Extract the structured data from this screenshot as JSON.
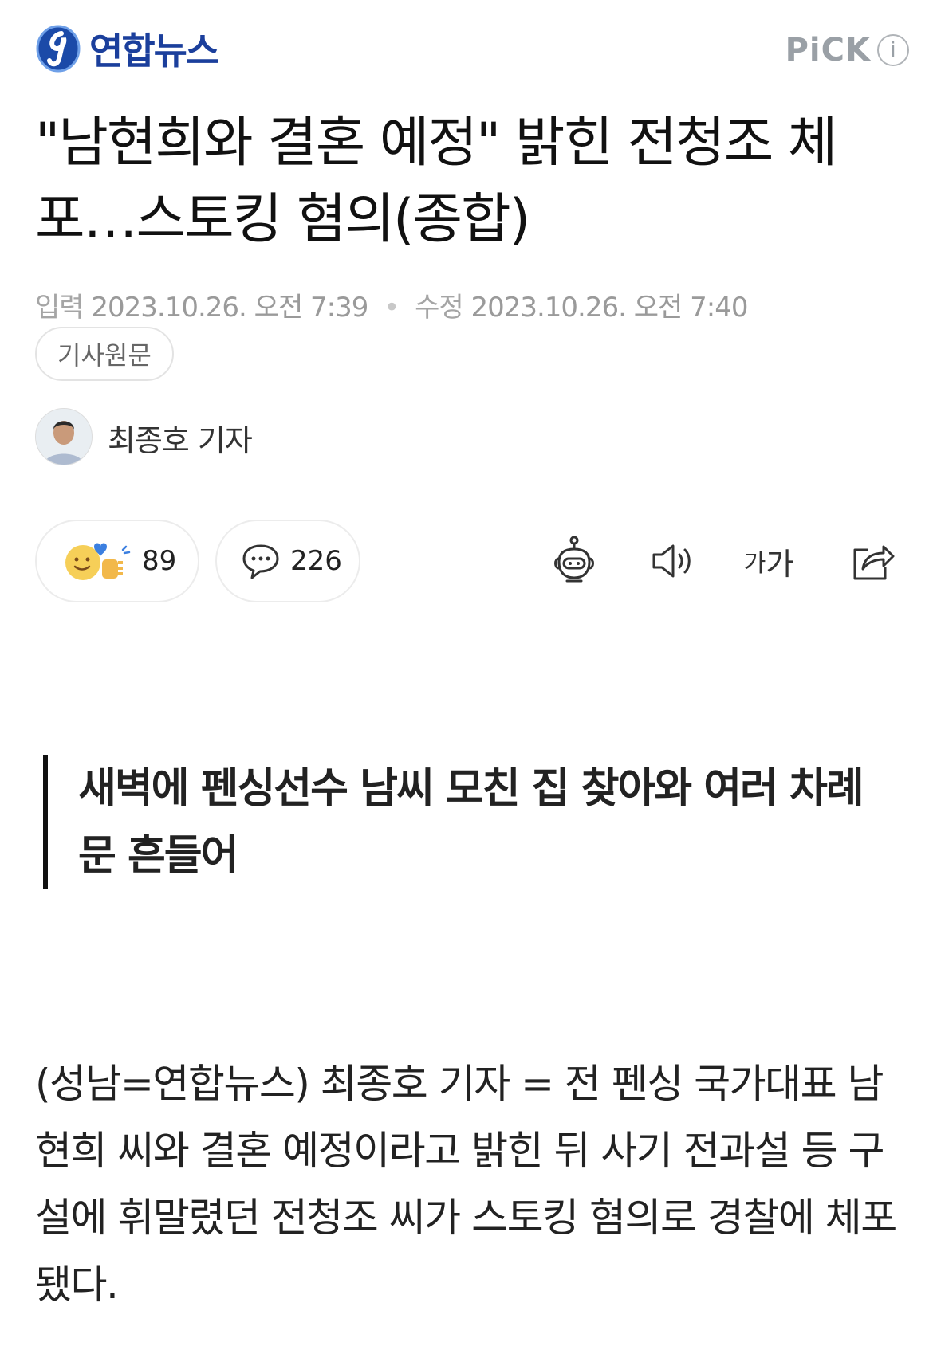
{
  "header": {
    "brand_name": "연합뉴스",
    "pick_label": "PiCK",
    "info_label": "i"
  },
  "article": {
    "title": "\"남현희와 결혼 예정\" 밝힌 전청조 체포…스토킹 혐의(종합)",
    "meta": {
      "input_label": "입력",
      "input_time": "2023.10.26. 오전 7:39",
      "separator": "•",
      "modified_label": "수정",
      "modified_time": "2023.10.26. 오전 7:40"
    },
    "original_button": "기사원문",
    "reporter": "최종호 기자",
    "summary": "새벽에 펜싱선수 남씨 모친 집 찾아와 여러 차례 문 흔들어",
    "body": "(성남=연합뉴스) 최종호 기자 = 전 펜싱 국가대표 남현희 씨와 결혼 예정이라고 밝힌 뒤 사기 전과설 등 구설에 휘말렸던 전청조 씨가 스토킹 혐의로 경찰에 체포됐다."
  },
  "reactions": {
    "like_count": "89",
    "comment_count": "226"
  },
  "tools": {
    "font_small": "가",
    "font_large": "가",
    "icons": [
      "robot-summary-icon",
      "speaker-icon",
      "font-size-icon",
      "share-icon"
    ]
  },
  "colors": {
    "brand": "#1b3f9c",
    "muted": "#9a9a9a"
  }
}
